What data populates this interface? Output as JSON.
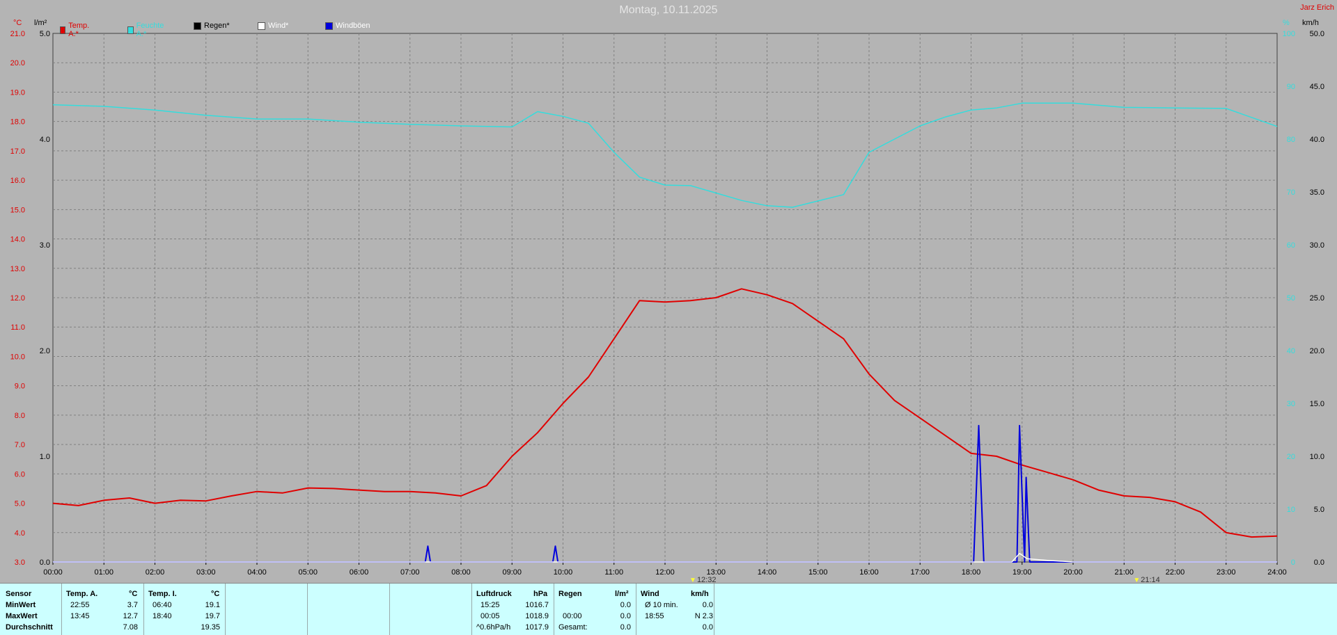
{
  "title": "Montag, 10.11.2025",
  "corner_label": "Jarz Erich",
  "units": {
    "left_outer": "°C",
    "left_inner": "l/m²",
    "right_inner": "%",
    "right_outer": "km/h"
  },
  "legend": [
    {
      "label": "Temp. A.*",
      "color": "#e00000",
      "text_color": "#e00000"
    },
    {
      "label": "Feuchte A.*",
      "color": "#33dddd",
      "text_color": "#33dddd"
    },
    {
      "label": "Regen*",
      "color": "#000000",
      "text_color": "#000000"
    },
    {
      "label": "Wind*",
      "color": "#ffffff",
      "text_color": "#ffffff"
    },
    {
      "label": "Windböen",
      "color": "#0000dd",
      "text_color": "#ffffff"
    }
  ],
  "colors": {
    "temp": "#e00000",
    "humidity": "#33dddd",
    "rain": "#000000",
    "wind": "#ffffff",
    "gust": "#0000dd",
    "grid": "#808080",
    "background": "#b4b4b4"
  },
  "events": [
    {
      "time": "12:32",
      "x_hour": 12.533
    },
    {
      "time": "21:14",
      "x_hour": 21.233
    }
  ],
  "chart_data": {
    "type": "line",
    "title": "Montag, 10.11.2025",
    "x_range": [
      0,
      24
    ],
    "x_ticks": [
      "00:00",
      "01:00",
      "02:00",
      "03:00",
      "04:00",
      "05:00",
      "06:00",
      "07:00",
      "08:00",
      "09:00",
      "10:00",
      "11:00",
      "12:00",
      "13:00",
      "14:00",
      "15:00",
      "16:00",
      "17:00",
      "18:00",
      "19:00",
      "20:00",
      "21:00",
      "22:00",
      "23:00",
      "24:00"
    ],
    "grid": true,
    "axes": {
      "temp": {
        "unit": "°C",
        "range": [
          3.0,
          21.0
        ],
        "ticks": [
          "3.0",
          "4.0",
          "5.0",
          "6.0",
          "7.0",
          "8.0",
          "9.0",
          "10.0",
          "11.0",
          "12.0",
          "13.0",
          "14.0",
          "15.0",
          "16.0",
          "17.0",
          "18.0",
          "19.0",
          "20.0",
          "21.0"
        ]
      },
      "rain": {
        "unit": "l/m²",
        "range": [
          0.0,
          5.0
        ],
        "ticks": [
          "0.0",
          "1.0",
          "2.0",
          "3.0",
          "4.0",
          "5.0"
        ]
      },
      "humidity": {
        "unit": "%",
        "range": [
          0,
          100
        ],
        "ticks": [
          "0",
          "10",
          "20",
          "30",
          "40",
          "50",
          "60",
          "70",
          "80",
          "90",
          "100"
        ]
      },
      "wind": {
        "unit": "km/h",
        "range": [
          0.0,
          50.0
        ],
        "ticks": [
          "0.0",
          "5.0",
          "10.0",
          "15.0",
          "20.0",
          "25.0",
          "30.0",
          "35.0",
          "40.0",
          "45.0",
          "50.0"
        ]
      }
    },
    "series": [
      {
        "name": "Temp. A.*",
        "axis": "temp",
        "points": [
          [
            0,
            5.0
          ],
          [
            0.5,
            4.92
          ],
          [
            1,
            5.1
          ],
          [
            1.5,
            5.18
          ],
          [
            2,
            5.0
          ],
          [
            2.5,
            5.1
          ],
          [
            3,
            5.08
          ],
          [
            3.5,
            5.25
          ],
          [
            4,
            5.4
          ],
          [
            4.5,
            5.35
          ],
          [
            5,
            5.52
          ],
          [
            5.5,
            5.5
          ],
          [
            6,
            5.45
          ],
          [
            6.5,
            5.4
          ],
          [
            7,
            5.4
          ],
          [
            7.5,
            5.35
          ],
          [
            8,
            5.25
          ],
          [
            8.5,
            5.6
          ],
          [
            9,
            6.6
          ],
          [
            9.5,
            7.4
          ],
          [
            10,
            8.4
          ],
          [
            10.5,
            9.3
          ],
          [
            11,
            10.6
          ],
          [
            11.5,
            11.9
          ],
          [
            12,
            11.85
          ],
          [
            12.5,
            11.9
          ],
          [
            13,
            12.0
          ],
          [
            13.5,
            12.3
          ],
          [
            14,
            12.1
          ],
          [
            14.5,
            11.8
          ],
          [
            15,
            11.2
          ],
          [
            15.5,
            10.6
          ],
          [
            16,
            9.4
          ],
          [
            16.5,
            8.5
          ],
          [
            17,
            7.9
          ],
          [
            17.5,
            7.3
          ],
          [
            18,
            6.7
          ],
          [
            18.5,
            6.6
          ],
          [
            19,
            6.3
          ],
          [
            19.5,
            6.05
          ],
          [
            20,
            5.8
          ],
          [
            20.5,
            5.45
          ],
          [
            21,
            5.25
          ],
          [
            21.5,
            5.2
          ],
          [
            22,
            5.05
          ],
          [
            22.5,
            4.7
          ],
          [
            23,
            4.0
          ],
          [
            23.5,
            3.85
          ],
          [
            24,
            3.88
          ]
        ]
      },
      {
        "name": "Feuchte A.*",
        "axis": "humidity",
        "points": [
          [
            0,
            86.5
          ],
          [
            1,
            86.2
          ],
          [
            2,
            85.5
          ],
          [
            3,
            84.5
          ],
          [
            4,
            83.8
          ],
          [
            5,
            83.8
          ],
          [
            6,
            83.2
          ],
          [
            7,
            82.8
          ],
          [
            8,
            82.5
          ],
          [
            9,
            82.3
          ],
          [
            9.5,
            85.2
          ],
          [
            10,
            84.3
          ],
          [
            10.5,
            83.0
          ],
          [
            11,
            77.5
          ],
          [
            11.5,
            72.8
          ],
          [
            12,
            71.3
          ],
          [
            12.5,
            71.2
          ],
          [
            13,
            69.8
          ],
          [
            13.5,
            68.4
          ],
          [
            14,
            67.4
          ],
          [
            14.5,
            67.1
          ],
          [
            15,
            68.3
          ],
          [
            15.5,
            69.5
          ],
          [
            16,
            77.5
          ],
          [
            16.5,
            80.0
          ],
          [
            17,
            82.5
          ],
          [
            17.5,
            84.2
          ],
          [
            18,
            85.5
          ],
          [
            18.5,
            85.9
          ],
          [
            19,
            86.8
          ],
          [
            20,
            86.8
          ],
          [
            21,
            86.0
          ],
          [
            22,
            85.9
          ],
          [
            23,
            85.8
          ],
          [
            24,
            82.4
          ]
        ]
      },
      {
        "name": "Windböen",
        "axis": "wind",
        "points": [
          [
            0,
            0
          ],
          [
            7.3,
            0
          ],
          [
            7.35,
            1.5
          ],
          [
            7.4,
            0
          ],
          [
            9.8,
            0
          ],
          [
            9.85,
            1.5
          ],
          [
            9.9,
            0
          ],
          [
            18.05,
            0
          ],
          [
            18.15,
            12.9
          ],
          [
            18.25,
            0
          ],
          [
            18.9,
            0
          ],
          [
            18.95,
            12.9
          ],
          [
            19.05,
            0
          ],
          [
            19.08,
            8.0
          ],
          [
            19.15,
            0
          ],
          [
            24,
            0
          ]
        ]
      },
      {
        "name": "Wind*",
        "axis": "wind",
        "points": [
          [
            0,
            0
          ],
          [
            18.8,
            0
          ],
          [
            18.95,
            0.8
          ],
          [
            19.1,
            0.3
          ],
          [
            19.5,
            0.15
          ],
          [
            20,
            0
          ],
          [
            24,
            0
          ]
        ]
      }
    ]
  },
  "stats": {
    "sensor": {
      "label": "Sensor",
      "rows": [
        "MinWert",
        "MaxWert",
        "Durchschnitt"
      ]
    },
    "temp_a": {
      "header": "Temp. A.",
      "unit": "°C",
      "min_time": "22:55",
      "min": "3.7",
      "max_time": "13:45",
      "max": "12.7",
      "avg": "7.08"
    },
    "temp_i": {
      "header": "Temp. I.",
      "unit": "°C",
      "min_time": "06:40",
      "min": "19.1",
      "max_time": "18:40",
      "max": "19.7",
      "avg": "19.35"
    },
    "pressure": {
      "header": "Luftdruck",
      "unit": "hPa",
      "min_time": "15:25",
      "min": "1016.7",
      "max_time": "00:05",
      "max": "1018.9",
      "trend": "^0.6hPa/h",
      "avg": "1017.9"
    },
    "rain": {
      "header": "Regen",
      "unit": "l/m²",
      "v1": "0.0",
      "time2": "00:00",
      "v2": "0.0",
      "total_label": "Gesamt:",
      "total": "0.0"
    },
    "wind": {
      "header": "Wind",
      "unit": "km/h",
      "avg_label": "Ø 10 min.",
      "avg": "0.0",
      "max_time": "18:55",
      "max": "N 2.3",
      "v3": "0.0"
    }
  }
}
